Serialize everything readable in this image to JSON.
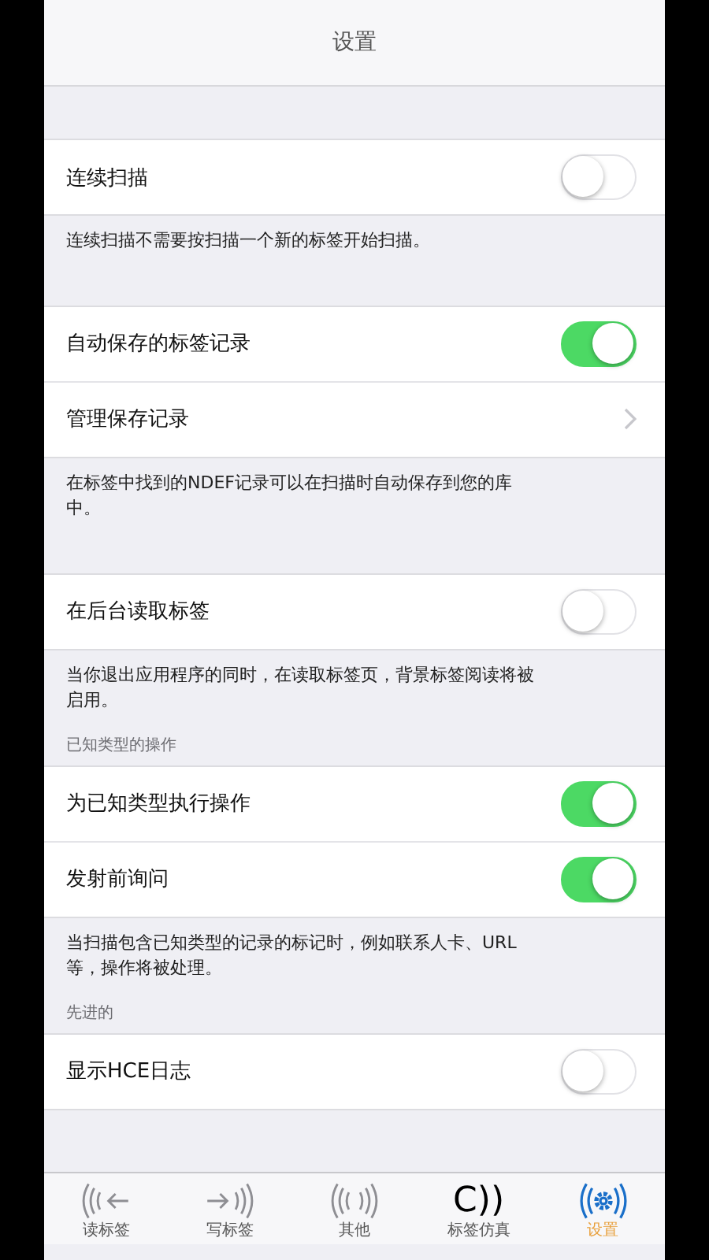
{
  "title": "设置",
  "sections": [
    {
      "rows": [
        {
          "kind": "toggle",
          "label": "连续扫描",
          "on": false
        }
      ],
      "footer": "连续扫描不需要按扫描一个新的标签开始扫描。"
    },
    {
      "rows": [
        {
          "kind": "toggle",
          "label": "自动保存的标签记录",
          "on": true
        },
        {
          "kind": "link",
          "label": "管理保存记录"
        }
      ],
      "footer": "在标签中找到的NDEF记录可以在扫描时自动保存到您的库中。"
    },
    {
      "rows": [
        {
          "kind": "toggle",
          "label": "在后台读取标签",
          "on": false
        }
      ],
      "footer": "当你退出应用程序的同时，在读取标签页，背景标签阅读将被启用。"
    },
    {
      "header": "已知类型的操作",
      "rows": [
        {
          "kind": "toggle",
          "label": "为已知类型执行操作",
          "on": true
        },
        {
          "kind": "toggle",
          "label": "发射前询问",
          "on": true
        }
      ],
      "footer": "当扫描包含已知类型的记录的标记时，例如联系人卡、URL等，操作将被处理。"
    },
    {
      "header": "先进的",
      "rows": [
        {
          "kind": "toggle",
          "label": "显示HCE日志",
          "on": false
        }
      ]
    }
  ],
  "tabs": [
    {
      "kind": "read",
      "label": "读标签",
      "selected": false
    },
    {
      "kind": "write",
      "label": "写标签",
      "selected": false
    },
    {
      "kind": "other",
      "label": "其他",
      "selected": false
    },
    {
      "kind": "glyph",
      "glyph": "C))",
      "label": "标签仿真",
      "selected": false
    },
    {
      "kind": "settings",
      "label": "设置",
      "selected": true
    }
  ]
}
